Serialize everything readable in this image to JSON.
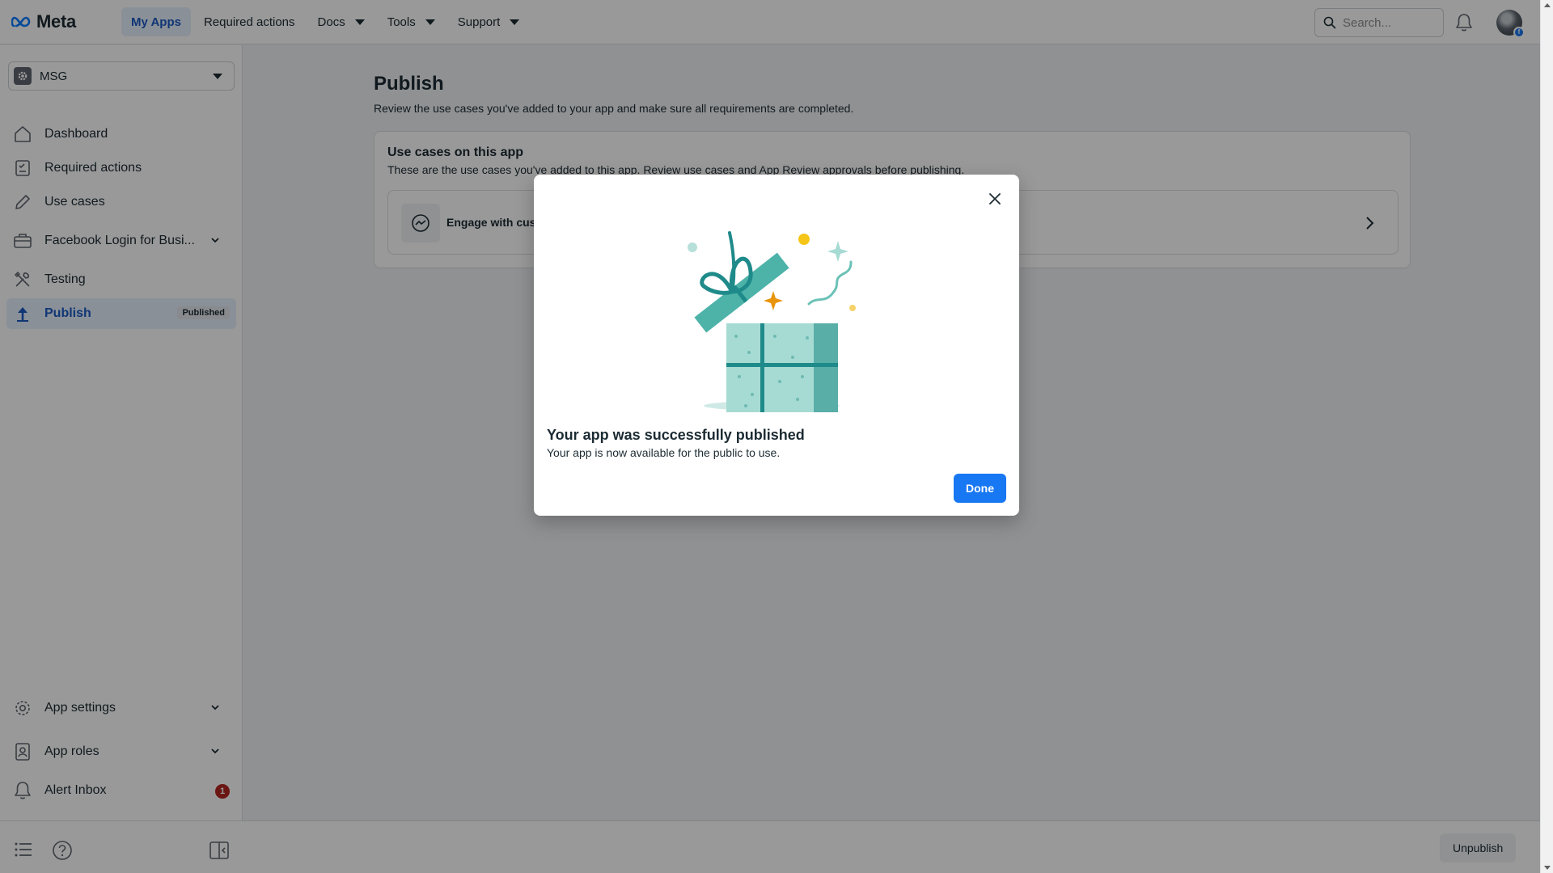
{
  "topbar": {
    "brand": "Meta",
    "nav": [
      {
        "label": "My Apps",
        "active": true,
        "dropdown": false
      },
      {
        "label": "Required actions",
        "active": false,
        "dropdown": false
      },
      {
        "label": "Docs",
        "active": false,
        "dropdown": true
      },
      {
        "label": "Tools",
        "active": false,
        "dropdown": true
      },
      {
        "label": "Support",
        "active": false,
        "dropdown": true
      }
    ],
    "search_placeholder": "Search..."
  },
  "sidebar": {
    "app_name": "MSG",
    "items": [
      {
        "label": "Dashboard",
        "icon": "home-icon"
      },
      {
        "label": "Required actions",
        "icon": "checklist-icon"
      },
      {
        "label": "Use cases",
        "icon": "pencil-icon"
      },
      {
        "label": "Facebook Login for Busi...",
        "icon": "briefcase-icon"
      },
      {
        "label": "Testing",
        "icon": "tools-icon"
      },
      {
        "label": "Publish",
        "icon": "upload-icon",
        "badge": "Published"
      },
      {
        "label": "App settings",
        "icon": "gear-icon"
      },
      {
        "label": "App roles",
        "icon": "person-badge-icon"
      },
      {
        "label": "Alert Inbox",
        "icon": "bell-icon",
        "count": "1"
      }
    ]
  },
  "main": {
    "title": "Publish",
    "subtitle": "Review the use cases you've added to your app and make sure all requirements are completed.",
    "card": {
      "title": "Use cases on this app",
      "subtitle": "These are the use cases you've added to this app. Review use cases and App Review approvals before publishing.",
      "usecase_label": "Engage with custo"
    }
  },
  "modal": {
    "title": "Your app was successfully published",
    "body": "Your app is now available for the public to use.",
    "done_label": "Done"
  },
  "bottombar": {
    "unpublish_label": "Unpublish"
  },
  "colors": {
    "accent": "#1877f2",
    "active_nav_bg": "#e7f0fd",
    "active_nav_text": "#1b5bc4",
    "alert_red": "#b3261e",
    "gift_teal": "#1f8a8a"
  }
}
